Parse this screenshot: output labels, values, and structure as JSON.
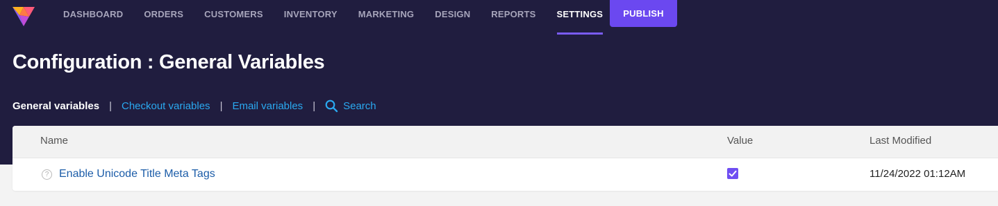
{
  "nav": {
    "items": [
      "DASHBOARD",
      "ORDERS",
      "CUSTOMERS",
      "INVENTORY",
      "MARKETING",
      "DESIGN",
      "REPORTS",
      "SETTINGS"
    ],
    "active": "SETTINGS",
    "publish_label": "PUBLISH"
  },
  "page": {
    "title": "Configuration : General Variables"
  },
  "subnav": {
    "items": [
      "General variables",
      "Checkout variables",
      "Email variables"
    ],
    "active": "General variables",
    "search_label": "Search"
  },
  "table": {
    "columns": {
      "name": "Name",
      "value": "Value",
      "last_modified": "Last Modified"
    },
    "rows": [
      {
        "name": "Enable Unicode Title Meta Tags",
        "value": true,
        "last_modified": "11/24/2022 01:12AM"
      }
    ]
  },
  "colors": {
    "header_bg": "#201d3f",
    "accent": "#6b48f0",
    "link": "#2aa9f0",
    "row_link": "#1b5ca8"
  },
  "icons": [
    "app-logo-icon",
    "search-icon",
    "help-icon",
    "checkmark-icon"
  ]
}
